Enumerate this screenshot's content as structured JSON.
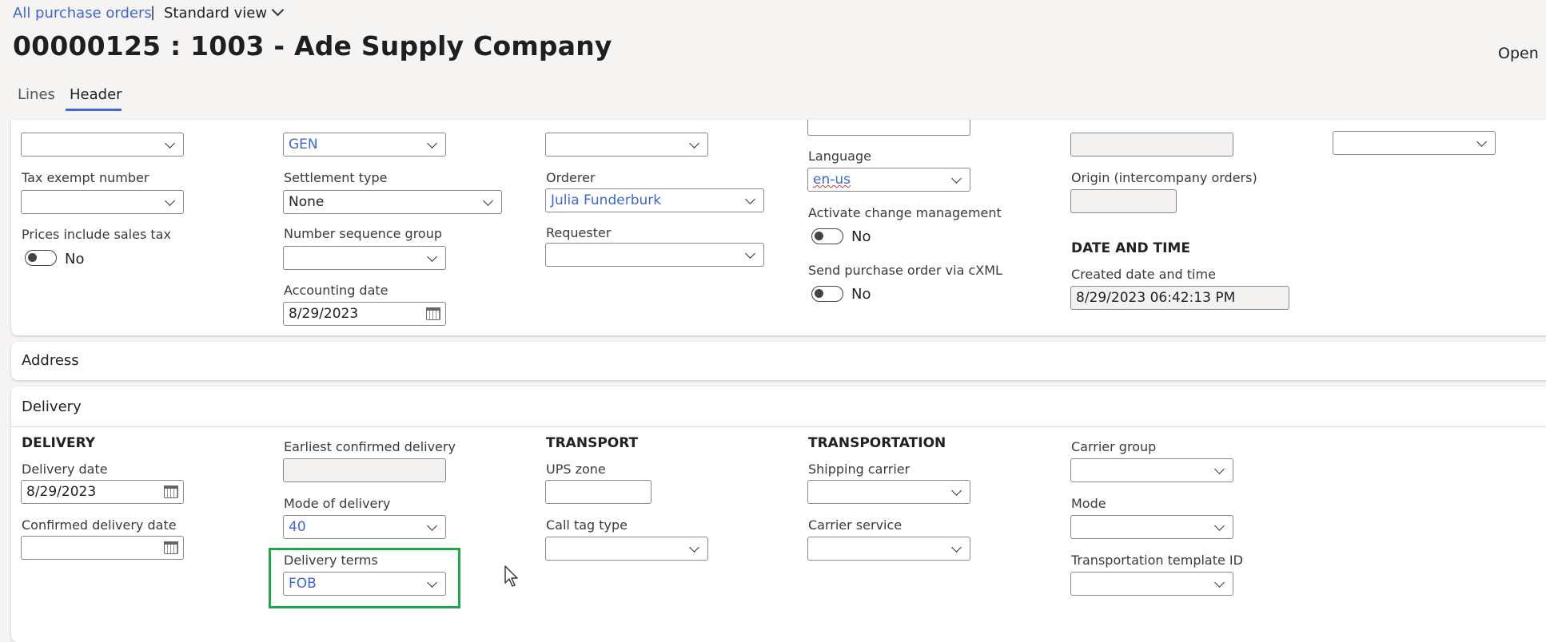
{
  "breadcrumb": {
    "link": "All purchase orders",
    "separator": "|",
    "view": "Standard view"
  },
  "page_title": "00000125 : 1003 - Ade Supply Company",
  "status": "Open",
  "tabs": [
    {
      "label": "Lines"
    },
    {
      "label": "Header"
    }
  ],
  "general": {
    "col1_top_value": "",
    "tax_exempt_label": "Tax exempt number",
    "tax_exempt_value": "",
    "prices_incl_tax_label": "Prices include sales tax",
    "prices_incl_tax_value": "No",
    "col2_top_value": "GEN",
    "settlement_type_label": "Settlement type",
    "settlement_type_value": "None",
    "number_seq_label": "Number sequence group",
    "number_seq_value": "",
    "accounting_date_label": "Accounting date",
    "accounting_date_value": "8/29/2023",
    "col3_top_value": "",
    "orderer_label": "Orderer",
    "orderer_value": "Julia Funderburk",
    "requester_label": "Requester",
    "requester_value": "",
    "language_label": "Language",
    "language_value": "en-us",
    "activate_change_label": "Activate change management",
    "activate_change_value": "No",
    "send_cxml_label": "Send purchase order via cXML",
    "send_cxml_value": "No",
    "origin_label": "Origin (intercompany orders)",
    "origin_value": "",
    "datetime_heading": "DATE AND TIME",
    "created_label": "Created date and time",
    "created_value": "8/29/2023 06:42:13 PM"
  },
  "address": {
    "title": "Address"
  },
  "delivery": {
    "title": "Delivery",
    "delivery_heading": "DELIVERY",
    "delivery_date_label": "Delivery date",
    "delivery_date_value": "8/29/2023",
    "confirmed_date_label": "Confirmed delivery date",
    "confirmed_date_value": "",
    "earliest_confirmed_label": "Earliest confirmed delivery",
    "earliest_confirmed_value": "",
    "mode_of_delivery_label": "Mode of delivery",
    "mode_of_delivery_value": "40",
    "delivery_terms_label": "Delivery terms",
    "delivery_terms_value": "FOB",
    "transport_heading": "TRANSPORT",
    "ups_zone_label": "UPS zone",
    "ups_zone_value": "",
    "call_tag_label": "Call tag type",
    "call_tag_value": "",
    "transportation_heading": "TRANSPORTATION",
    "shipping_carrier_label": "Shipping carrier",
    "shipping_carrier_value": "",
    "carrier_service_label": "Carrier service",
    "carrier_service_value": "",
    "carrier_group_label": "Carrier group",
    "carrier_group_value": "",
    "mode_label": "Mode",
    "mode_value": "",
    "template_label": "Transportation template ID",
    "template_value": ""
  },
  "colors": {
    "accent": "#3f66d4",
    "highlight": "#1ea84a",
    "background": "#f5f4f3"
  }
}
